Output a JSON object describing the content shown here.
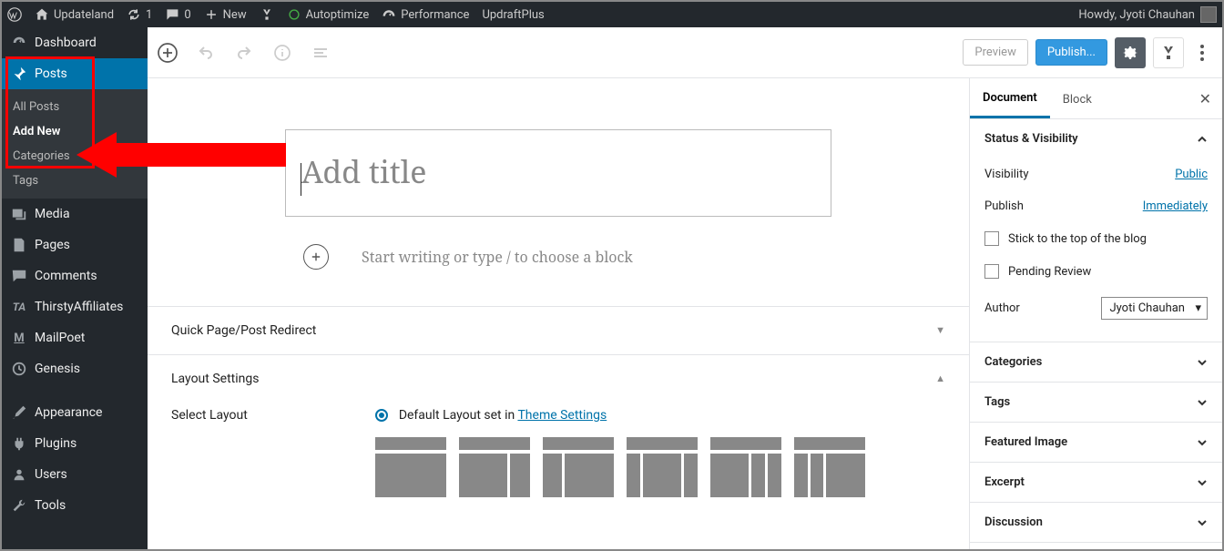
{
  "adminbar": {
    "site_name": "Updateland",
    "updates_count": "1",
    "comments_count": "0",
    "new_label": "New",
    "autoptimize": "Autoptimize",
    "performance": "Performance",
    "updraft": "UpdraftPlus",
    "howdy": "Howdy, Jyoti Chauhan"
  },
  "sidebar": {
    "dashboard": "Dashboard",
    "posts": "Posts",
    "posts_sub": {
      "all": "All Posts",
      "add": "Add New",
      "cat": "Categories",
      "tags": "Tags"
    },
    "media": "Media",
    "pages": "Pages",
    "comments": "Comments",
    "thirsty": "ThirstyAffiliates",
    "mailpoet": "MailPoet",
    "genesis": "Genesis",
    "appearance": "Appearance",
    "plugins": "Plugins",
    "users": "Users",
    "tools": "Tools"
  },
  "editor": {
    "preview": "Preview",
    "publish": "Publish...",
    "title_placeholder": "Add title",
    "block_prompt": "Start writing or type / to choose a block",
    "panel_redirect": "Quick Page/Post Redirect",
    "panel_layout": "Layout Settings",
    "select_layout": "Select Layout",
    "default_layout_text": "Default Layout set in ",
    "theme_settings_link": "Theme Settings"
  },
  "settings": {
    "tab_document": "Document",
    "tab_block": "Block",
    "status_head": "Status & Visibility",
    "visibility_label": "Visibility",
    "visibility_value": "Public",
    "publish_label": "Publish",
    "publish_value": "Immediately",
    "stick_label": "Stick to the top of the blog",
    "pending_label": "Pending Review",
    "author_label": "Author",
    "author_value": "Jyoti Chauhan",
    "categories": "Categories",
    "tags": "Tags",
    "featured": "Featured Image",
    "excerpt": "Excerpt",
    "discussion": "Discussion"
  }
}
